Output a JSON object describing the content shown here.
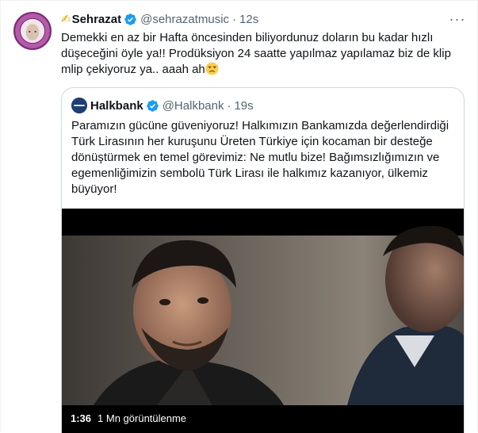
{
  "tweet": {
    "author": {
      "display_name": "Sehrazat",
      "prefix_icon": "pen-emoji",
      "handle": "@sehrazatmusic",
      "separator": "·",
      "time": "12s",
      "verified": true
    },
    "more_label": "···",
    "text": "Demekki en az bir Hafta öncesinden biliyordunuz doların bu kadar hızlı\ndüşeceğini öyle ya!! Prodüksiyon 24 saatte yapılmaz yapılamaz biz de klip\nmlip çekiyoruz ya.. aaah ah",
    "trailing_emoji": "unamused-face-emoji"
  },
  "quote": {
    "author": {
      "display_name": "Halkbank",
      "handle": "@Halkbank",
      "separator": "·",
      "time": "19s",
      "verified": true
    },
    "text": "Paramızın gücüne güveniyoruz! Halkımızın Bankamızda değerlendirdiği Türk Lirasının her kuruşunu Üreten Türkiye için kocaman bir desteğe dönüştürmek en temel görevimiz: Ne mutlu bize! Bağımsızlığımızın ve egemenliğimizin sembolü Türk Lirası ile halkımız kazanıyor, ülkemiz büyüyor!",
    "video": {
      "duration": "1:36",
      "views": "1 Mn görüntülenme"
    }
  },
  "colors": {
    "verified": "#1d9bf0",
    "secondary_text": "#536471",
    "border": "#cfd9de"
  }
}
